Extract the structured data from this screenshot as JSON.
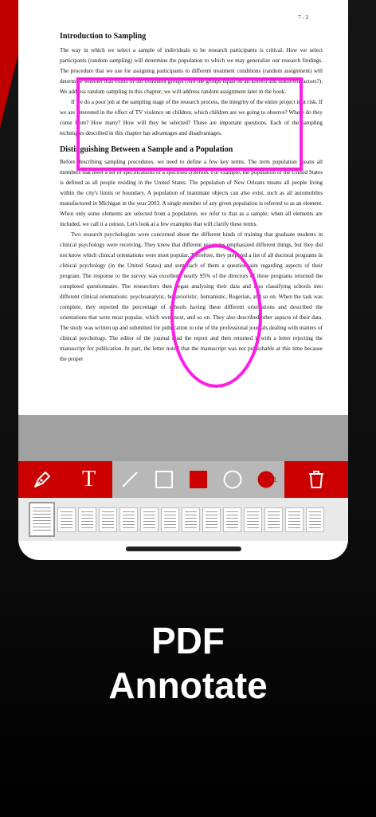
{
  "document": {
    "page_number": "7 - 2",
    "heading1": "Introduction to Sampling",
    "para1": "The way in which we select a sample of individuals to be research participants is critical. How we select participants (random sampling) will determine the population to which we may generalize our research findings. The procedure that we use for assigning participants to different treatment conditions (random assignment) will determine whether bias exists in our treatment groups (Are the groups equal on all known and unknown factors?). We address random sampling in this chapter; we will address random assignment later in the book.",
    "para2": "If we do a poor job at the sampling stage of the research process, the integrity of the entire project is at risk. If we are interested in the effect of TV violence on children, which children are we going to observe? Where do they come from? How many? How will they be selected? These are important questions. Each of the sampling techniques described in this chapter has advantages and disadvantages.",
    "heading2": "Distinguishing Between a Sample and a Population",
    "para3": "Before describing sampling procedures, we need to define a few key terms. The term population means all members that meet a set of specifications or a specified criterion. For example, the population of the United States is defined as all people residing in the United States. The population of New Orleans means all people living within the city's limits or boundary. A population of inanimate objects can also exist, such as all automobiles manufactured in Michigan in the year 2003. A single member of any given population is referred to as an element. When only some elements are selected from a population, we refer to that as a sample; when all elements are included, we call it a census. Let's look at a few examples that will clarify these terms.",
    "para4": "Two research psychologists were concerned about the different kinds of training that graduate students in clinical psychology were receiving. They knew that different programs emphasized different things, but they did not know which clinical orientations were most popular. Therefore, they prepared a list of all doctoral programs in clinical psychology (in the United States) and sent each of them a questionnaire regarding aspects of their program. The response to the survey was excellent; nearly 95% of the directors of these programs returned the completed questionnaire. The researchers then began analyzing their data and also classifying schools into different clinical orientations: psychoanalytic, behavioristic, humanistic, Rogerian, and so on. When the task was complete, they reported the percentage of schools having these different orientations and described the orientations that were most popular, which were next, and so on. They also described other aspects of their data. The study was written up and submitted for publication to one of the professional journals dealing with matters of clinical psychology. The editor of the journal read the report and then returned it with a letter rejecting the manuscript for publication. In part, the letter noted that the manuscript was not publishable at this time because the proper"
  },
  "toolbar": {
    "text_tool_glyph": "T",
    "icons": {
      "pen": "pen-icon",
      "text": "text-icon",
      "line": "line-icon",
      "rect_outline": "rectangle-outline-icon",
      "rect_filled": "rectangle-filled-icon",
      "circle_outline": "circle-outline-icon",
      "circle_filled": "circle-filled-icon",
      "trash": "trash-icon"
    },
    "colors": {
      "accent": "#cc0000",
      "annotation": "#ff1de6"
    }
  },
  "caption": {
    "line1": "PDF",
    "line2": "Annotate"
  }
}
